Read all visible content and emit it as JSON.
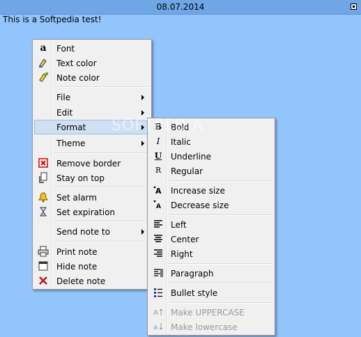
{
  "window": {
    "title": "08.07.2014"
  },
  "note": {
    "text": "This is a Softpedia test!"
  },
  "watermark": "SOFTPEDIA",
  "context_menu": {
    "items": [
      {
        "label": "Font",
        "icon": "font-icon"
      },
      {
        "label": "Text color",
        "icon": "text-color-icon"
      },
      {
        "label": "Note color",
        "icon": "note-color-icon"
      },
      {
        "label": "File",
        "submenu": true
      },
      {
        "label": "Edit",
        "submenu": true
      },
      {
        "label": "Format",
        "submenu": true
      },
      {
        "label": "Theme",
        "submenu": true
      },
      {
        "label": "Remove border",
        "icon": "remove-border-icon"
      },
      {
        "label": "Stay on top",
        "icon": "stay-on-top-icon"
      },
      {
        "label": "Set alarm",
        "icon": "alarm-bell-icon"
      },
      {
        "label": "Set expiration",
        "icon": "hourglass-icon"
      },
      {
        "label": "Send note to",
        "submenu": true
      },
      {
        "label": "Print note",
        "icon": "printer-icon"
      },
      {
        "label": "Hide note",
        "icon": "hide-window-icon"
      },
      {
        "label": "Delete note",
        "icon": "delete-x-icon"
      }
    ]
  },
  "format_submenu": {
    "items": [
      {
        "label": "Bold",
        "icon": "bold-icon"
      },
      {
        "label": "Italic",
        "icon": "italic-icon"
      },
      {
        "label": "Underline",
        "icon": "underline-icon"
      },
      {
        "label": "Regular",
        "icon": "regular-icon"
      },
      {
        "label": "Increase size",
        "icon": "increase-size-icon"
      },
      {
        "label": "Decrease size",
        "icon": "decrease-size-icon"
      },
      {
        "label": "Left",
        "icon": "align-left-icon"
      },
      {
        "label": "Center",
        "icon": "align-center-icon"
      },
      {
        "label": "Right",
        "icon": "align-right-icon"
      },
      {
        "label": "Paragraph",
        "icon": "paragraph-icon"
      },
      {
        "label": "Bullet style",
        "icon": "bullet-list-icon"
      },
      {
        "label": "Make UPPERCASE",
        "icon": "uppercase-icon",
        "disabled": true
      },
      {
        "label": "Make lowercase",
        "icon": "lowercase-icon",
        "disabled": true
      }
    ]
  },
  "colors": {
    "note_background": "#93c5fd",
    "titlebar": "#6fa6e6",
    "menu_background": "#f0f0f0",
    "highlight": "#cfe0f5"
  }
}
